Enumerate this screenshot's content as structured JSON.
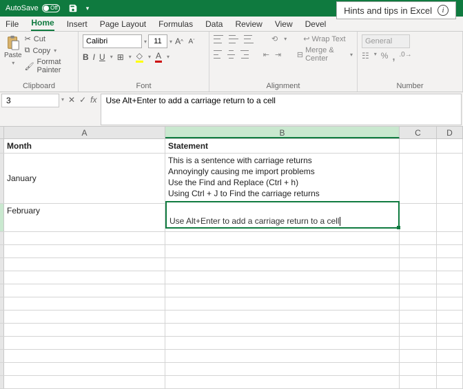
{
  "titlebar": {
    "autosave": "AutoSave",
    "toggle": "Off"
  },
  "overlay": {
    "text": "Hints and tips in Excel"
  },
  "tabs": {
    "file": "File",
    "home": "Home",
    "insert": "Insert",
    "pagelayout": "Page Layout",
    "formulas": "Formulas",
    "data": "Data",
    "review": "Review",
    "view": "View",
    "developer": "Devel"
  },
  "ribbon": {
    "clipboard": {
      "label": "Clipboard",
      "paste": "Paste",
      "cut": "Cut",
      "copy": "Copy",
      "format_painter": "Format Painter"
    },
    "font": {
      "label": "Font",
      "name": "Calibri",
      "size": "11",
      "bold": "B",
      "italic": "I",
      "underline": "U"
    },
    "alignment": {
      "label": "Alignment",
      "wrap": "Wrap Text",
      "merge": "Merge & Center"
    },
    "number": {
      "label": "Number",
      "format": "General",
      "pct": "%",
      "comma": ","
    }
  },
  "formulabar": {
    "namebox": "3",
    "content": "Use Alt+Enter to add a carriage return to a cell"
  },
  "grid": {
    "cols": {
      "A": "A",
      "B": "B",
      "C": "C",
      "D": "D"
    },
    "header": {
      "A": "Month",
      "B": "Statement"
    },
    "rows": [
      {
        "A": "January",
        "B": "This is a sentence with carriage returns\nAnnoyingly causing me import problems\nUse the Find and Replace (Ctrl + h)\nUsing Ctrl + J to Find the carriage returns"
      },
      {
        "A": "February",
        "B": "Use Alt+Enter to add a carriage return to a cell"
      }
    ],
    "editing_text": "Use Alt+Enter to add a carriage return to a cell"
  }
}
